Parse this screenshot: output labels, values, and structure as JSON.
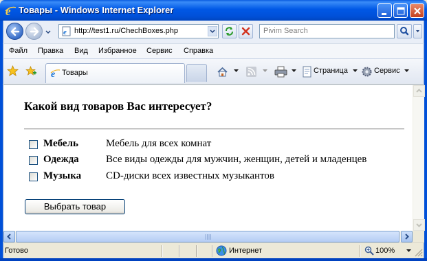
{
  "window": {
    "title": "Товары - Windows Internet Explorer"
  },
  "address_bar": {
    "url": "http://test1.ru/ChechBoxes.php"
  },
  "search_bar": {
    "placeholder": "Pivim Search"
  },
  "menu": {
    "items": [
      "Файл",
      "Правка",
      "Вид",
      "Избранное",
      "Сервис",
      "Справка"
    ]
  },
  "tab": {
    "title": "Товары"
  },
  "command_bar": {
    "page_label": "Страница",
    "tools_label": "Сервис"
  },
  "page": {
    "heading": "Какой вид товаров Вас интересует?",
    "options": [
      {
        "name": "Мебель",
        "description": "Мебель для всех комнат",
        "checked": false
      },
      {
        "name": "Одежда",
        "description": "Все виды одежды для мужчин, женщин, детей и младенцев",
        "checked": false
      },
      {
        "name": "Музыка",
        "description": "CD-диски всех известных музыкантов",
        "checked": false
      }
    ],
    "submit_label": "Выбрать товар"
  },
  "status_bar": {
    "status": "Готово",
    "zone": "Интернет",
    "zoom": "100%"
  }
}
